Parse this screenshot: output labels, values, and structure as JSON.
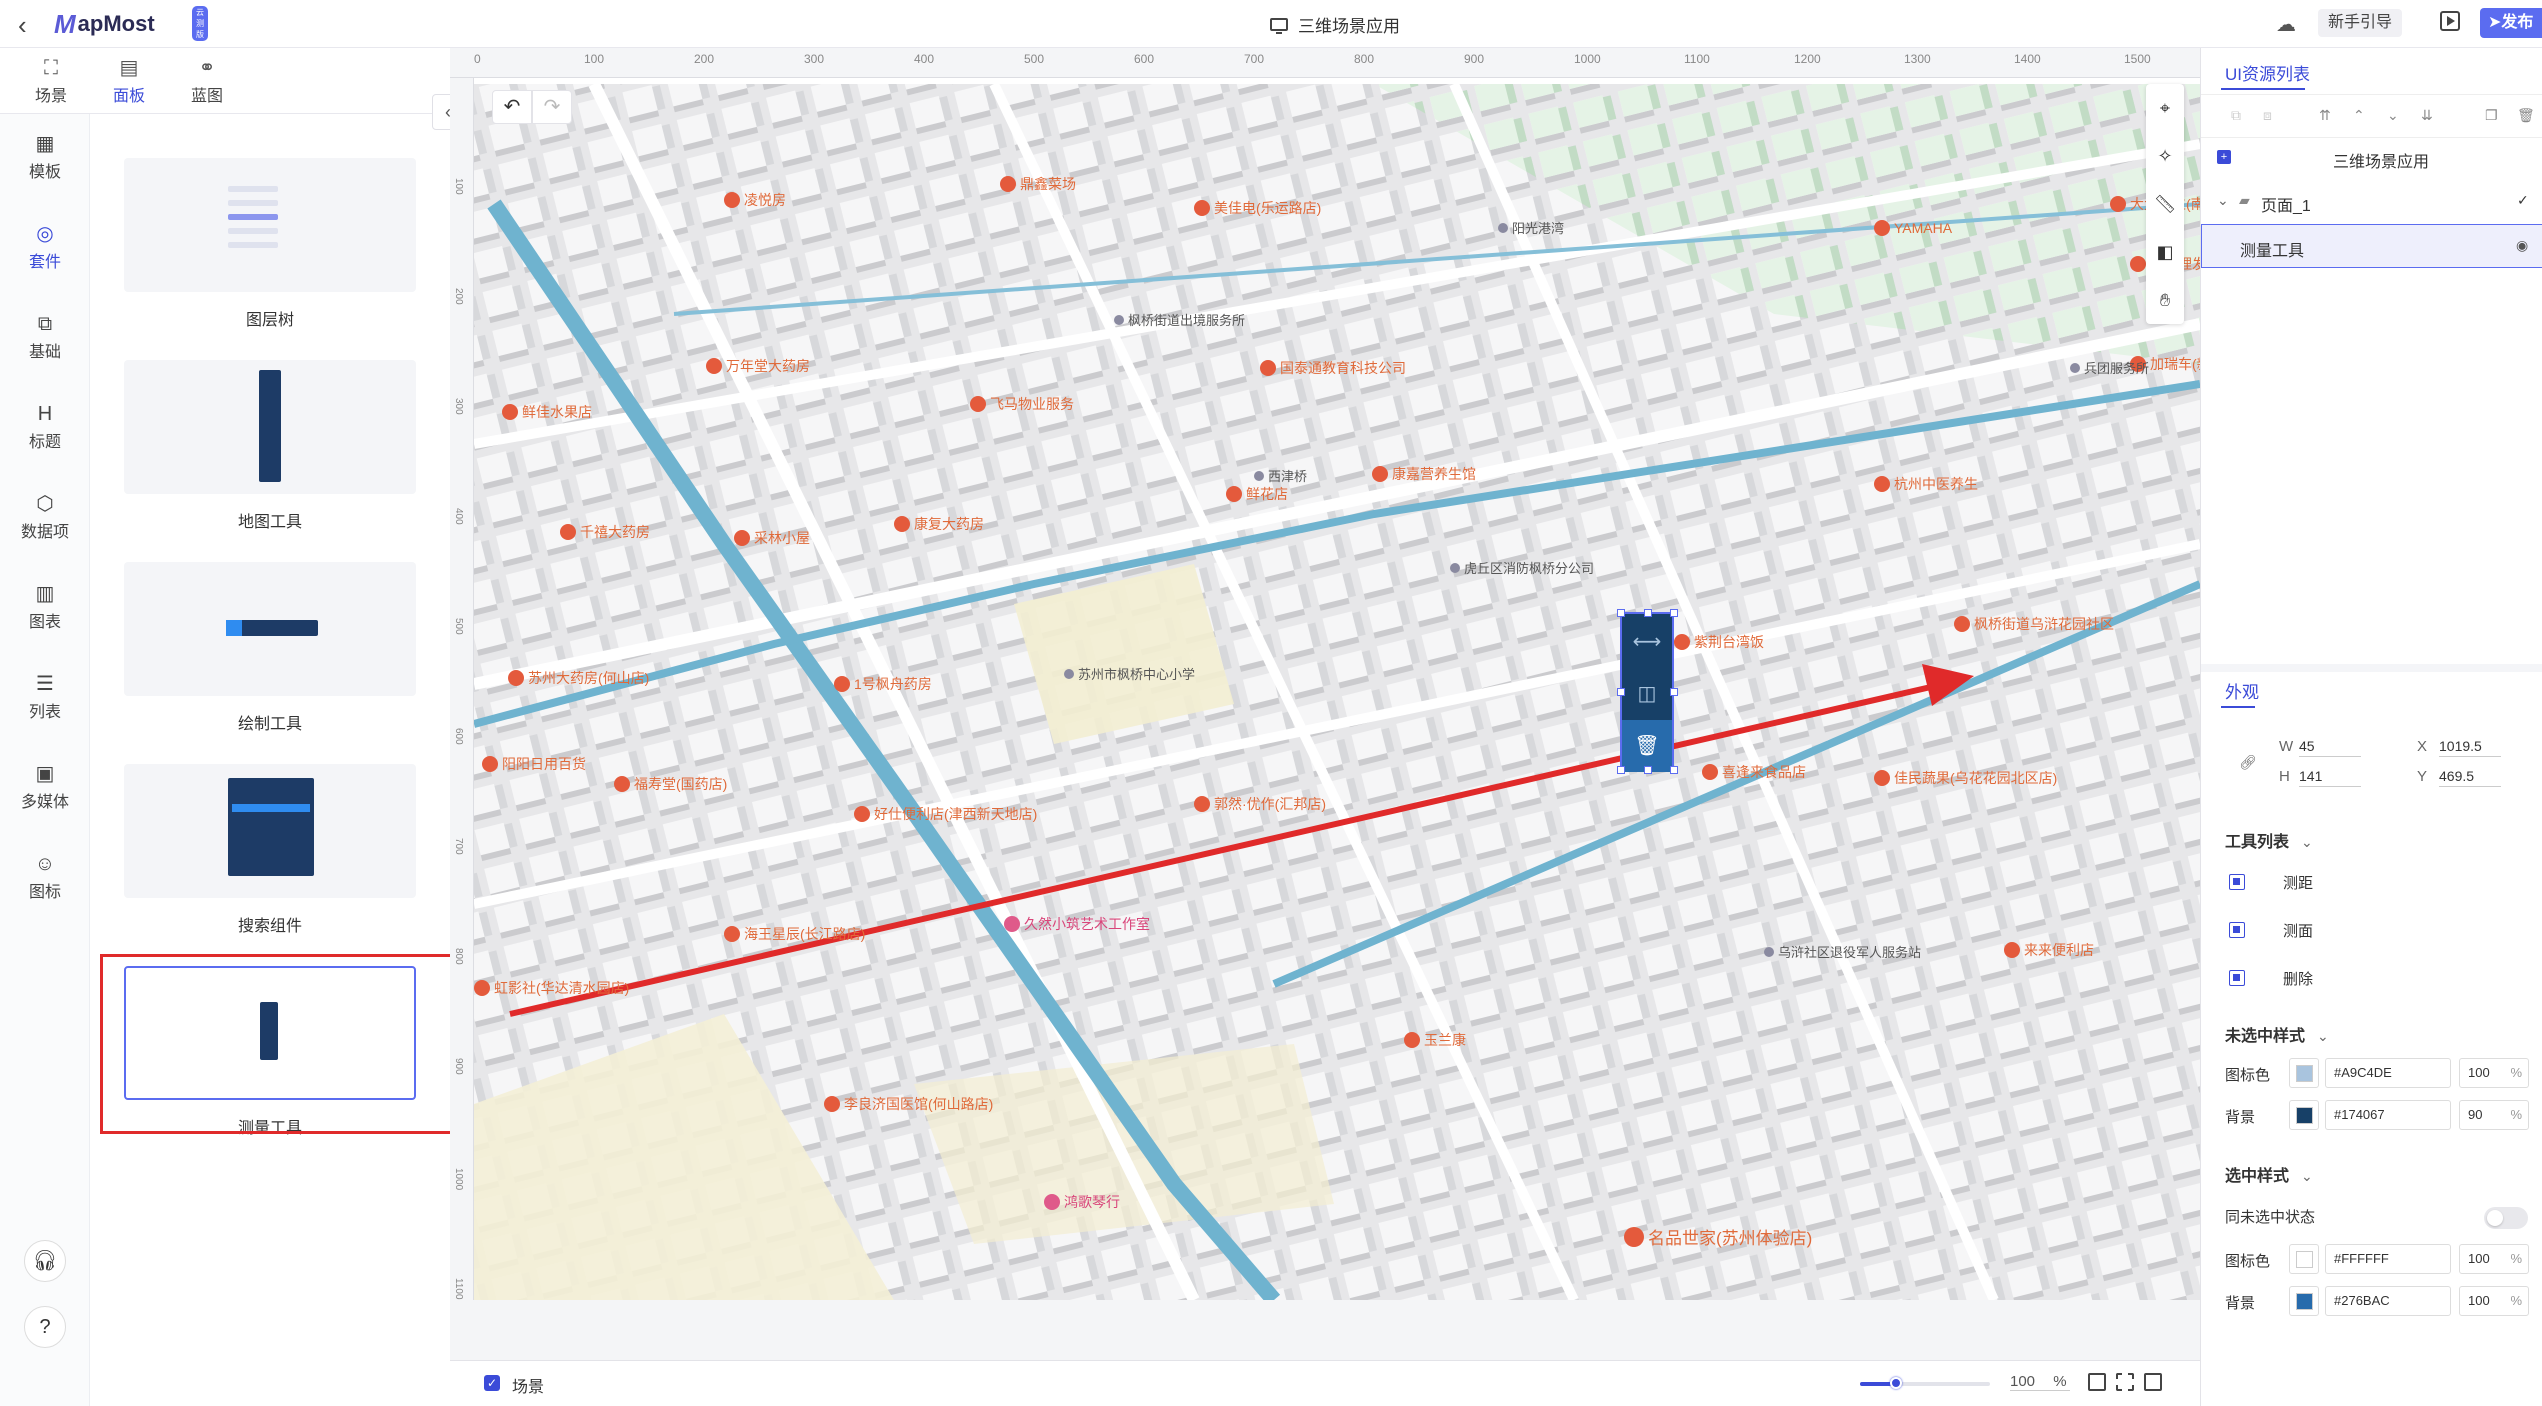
{
  "topbar": {
    "logo_mark": "M",
    "logo_text": "apMost",
    "logo_badge": "云测版",
    "app_title": "三维场景应用",
    "guide_label": "新手引导",
    "publish_label": "发布"
  },
  "top_tabs": [
    {
      "label": "场景",
      "icon": "scene-icon"
    },
    {
      "label": "面板",
      "icon": "panel-icon"
    },
    {
      "label": "蓝图",
      "icon": "blueprint-icon"
    }
  ],
  "rail": [
    {
      "label": "模板",
      "icon": "template-icon"
    },
    {
      "label": "套件",
      "icon": "kit-icon"
    },
    {
      "label": "基础",
      "icon": "basic-shapes-icon"
    },
    {
      "label": "标题",
      "icon": "heading-icon"
    },
    {
      "label": "数据项",
      "icon": "data-icon"
    },
    {
      "label": "图表",
      "icon": "chart-icon"
    },
    {
      "label": "列表",
      "icon": "list-icon"
    },
    {
      "label": "多媒体",
      "icon": "media-icon"
    },
    {
      "label": "图标",
      "icon": "emoji-icon"
    }
  ],
  "kits": [
    {
      "label": "图层树"
    },
    {
      "label": "地图工具"
    },
    {
      "label": "绘制工具"
    },
    {
      "label": "搜索组件"
    },
    {
      "label": "测量工具"
    }
  ],
  "ruler": {
    "h_ticks": [
      "0",
      "100",
      "200",
      "300",
      "400",
      "500",
      "600",
      "700",
      "800",
      "900",
      "1000",
      "1100",
      "1200",
      "1300",
      "1400",
      "1500"
    ],
    "v_ticks": [
      "100",
      "200",
      "300",
      "400",
      "500",
      "600",
      "700",
      "800",
      "900",
      "1000",
      "1100"
    ]
  },
  "map": {
    "pois": [
      {
        "text": "苏州市枫桥中心小学",
        "cls": "dark"
      },
      {
        "text": "久然小筑艺术工作室",
        "cls": "pink"
      },
      {
        "text": "鸿歌琴行",
        "cls": "pink"
      },
      {
        "text": "名品世家(苏州体验店)",
        "cls": "big"
      },
      {
        "text": "李良济国医馆(何山路店)",
        "cls": ""
      },
      {
        "text": "海王星辰(长江路店)",
        "cls": ""
      },
      {
        "text": "好仕便利店(津西新天地店)",
        "cls": ""
      },
      {
        "text": "福寿堂(国药店)",
        "cls": ""
      },
      {
        "text": "1号枫舟药房",
        "cls": ""
      },
      {
        "text": "苏州大药房(何山店)",
        "cls": ""
      },
      {
        "text": "阳阳日用百货",
        "cls": ""
      },
      {
        "text": "玉兰康",
        "cls": ""
      },
      {
        "text": "来来便利店",
        "cls": ""
      },
      {
        "text": "佳民蔬果(乌花花园北区店)",
        "cls": ""
      },
      {
        "text": "喜逢来食品店",
        "cls": ""
      },
      {
        "text": "乌浒社区退役军人服务站",
        "cls": "dark"
      },
      {
        "text": "枫桥街道乌浒花园社区",
        "cls": ""
      },
      {
        "text": "虎丘区消防枫桥分公司",
        "cls": "dark"
      },
      {
        "text": "西津桥",
        "cls": "dark"
      },
      {
        "text": "国泰通教育科技公司",
        "cls": ""
      },
      {
        "text": "飞马物业服务",
        "cls": ""
      },
      {
        "text": "康复大药房",
        "cls": ""
      },
      {
        "text": "采林小屋",
        "cls": ""
      },
      {
        "text": "千禧大药房",
        "cls": ""
      },
      {
        "text": "鲜佳水果店",
        "cls": ""
      },
      {
        "text": "万年堂大药房",
        "cls": ""
      },
      {
        "text": "康嘉营养生馆",
        "cls": ""
      },
      {
        "text": "鲜花店",
        "cls": ""
      },
      {
        "text": "凌悦房",
        "cls": ""
      },
      {
        "text": "美佳电(乐运路店)",
        "cls": ""
      },
      {
        "text": "鼎鑫菜场",
        "cls": ""
      },
      {
        "text": "加瑞车(新港花园店)",
        "cls": ""
      },
      {
        "text": "杭州中医养生",
        "cls": ""
      },
      {
        "text": "YAMAHA",
        "cls": ""
      },
      {
        "text": "大大鑫生(南园店)",
        "cls": ""
      },
      {
        "text": "郭朋理发店",
        "cls": ""
      },
      {
        "text": "兵团服务所",
        "cls": "dark"
      },
      {
        "text": "枫桥街道出境服务所",
        "cls": "dark"
      },
      {
        "text": "虹影社(华达清水园店)",
        "cls": ""
      },
      {
        "text": "郭然·优作(汇邦店)",
        "cls": ""
      },
      {
        "text": "紫荆台湾饭",
        "cls": ""
      },
      {
        "text": "阳光港湾",
        "cls": "dark"
      }
    ]
  },
  "widget": {
    "tools": [
      {
        "name": "测距",
        "icon": "ruler-icon"
      },
      {
        "name": "测面",
        "icon": "area-icon"
      },
      {
        "name": "删除",
        "icon": "trash-icon"
      }
    ]
  },
  "statusbar": {
    "scene_label": "场景",
    "zoom_value": "100",
    "zoom_unit": "%",
    "zoom_fraction": 0.28
  },
  "rpanel": {
    "resources_tab": "UI资源列表",
    "tree": {
      "root": "三维场景应用",
      "page": "页面_1",
      "layer": "测量工具"
    },
    "appearance_tab": "外观",
    "geometry": {
      "w": "45",
      "h": "141",
      "x": "1019.5",
      "y": "469.5",
      "w_label": "W",
      "h_label": "H",
      "x_label": "X",
      "y_label": "Y"
    },
    "tool_list_title": "工具列表",
    "tools": [
      "测距",
      "测面",
      "删除"
    ],
    "unselected_title": "未选中样式",
    "unselected": [
      {
        "label": "图标色",
        "hex": "#A9C4DE",
        "pct": "100",
        "color": "#A9C4DE"
      },
      {
        "label": "背景",
        "hex": "#174067",
        "pct": "90",
        "color": "#174067"
      }
    ],
    "selected_title": "选中样式",
    "sync_label": "同未选中状态",
    "selected": [
      {
        "label": "图标色",
        "hex": "#FFFFFF",
        "pct": "100",
        "color": "#FFFFFF"
      },
      {
        "label": "背景",
        "hex": "#276BAC",
        "pct": "100",
        "color": "#276BAC"
      }
    ],
    "pct_unit": "%"
  }
}
